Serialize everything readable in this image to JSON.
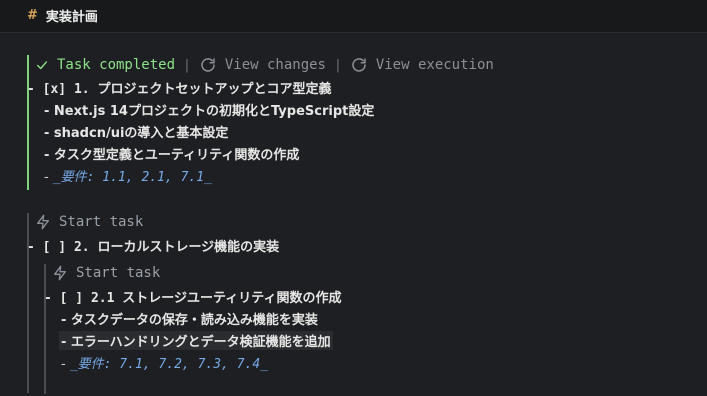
{
  "header": {
    "hash": "#",
    "title": "実装計画"
  },
  "task1": {
    "status_label": "Task completed",
    "sep": "|",
    "view_changes": "View changes",
    "view_execution": "View execution",
    "line": "- [x] 1. プロジェクトセットアップとコア型定義",
    "items": [
      "- Next.js 14プロジェクトの初期化とTypeScript設定",
      "- shadcn/uiの導入と基本設定",
      "- タスク型定義とユーティリティ関数の作成"
    ],
    "req_prefix": "- ",
    "req": "_要件: 1.1, 2.1, 7.1_"
  },
  "task2": {
    "start_label": "Start task",
    "line": "- [ ] 2. ローカルストレージ機能の実装"
  },
  "task21": {
    "start_label": "Start task",
    "line": "- [ ] 2.1 ストレージユーティリティ関数の作成",
    "items": [
      "- タスクデータの保存・読み込み機能を実装",
      "- エラーハンドリングとデータ検証機能を追加"
    ],
    "req_prefix": "- ",
    "req": "_要件: 7.1, 7.2, 7.3, 7.4_"
  },
  "colors": {
    "bg": "#1e1f22",
    "accent_green": "#8ee38a",
    "muted": "#8b8f97",
    "link_blue": "#76a9e6"
  },
  "icons": [
    "check-icon",
    "view-changes-icon",
    "view-execution-icon",
    "lightning-icon"
  ]
}
